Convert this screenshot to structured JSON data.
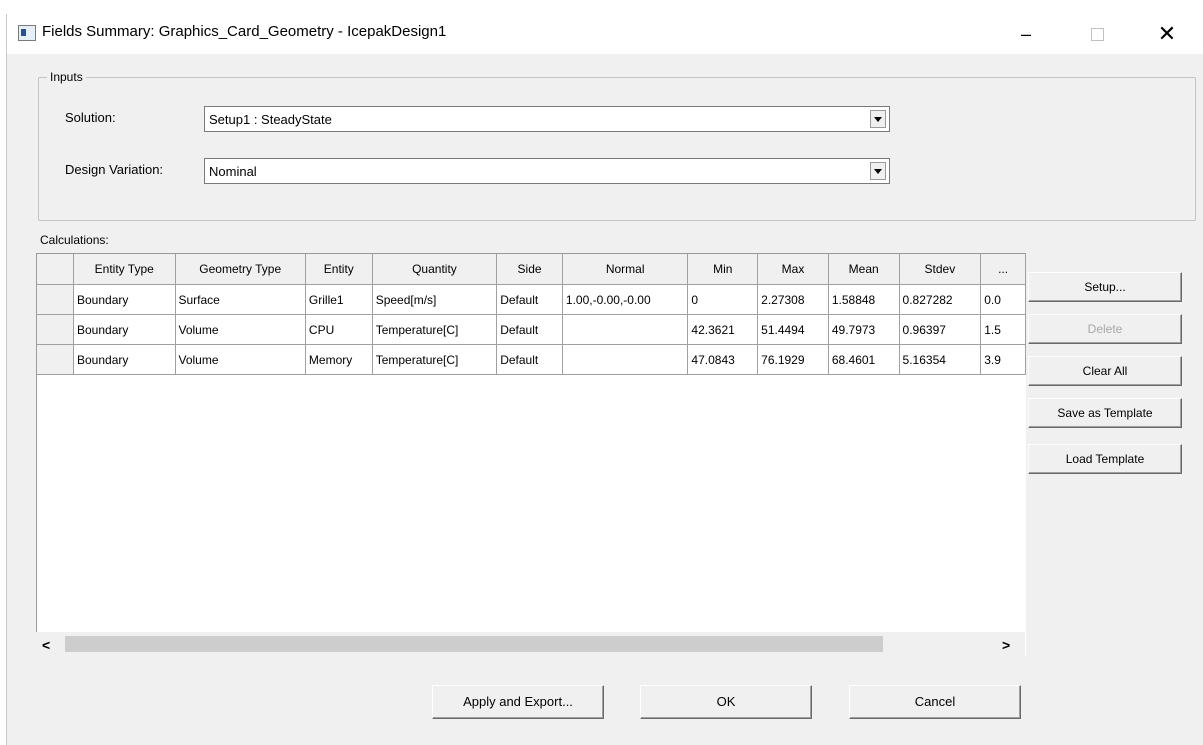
{
  "window": {
    "title": "Fields Summary: Graphics_Card_Geometry - IcepakDesign1",
    "minimize": "–",
    "close": "✕"
  },
  "inputs": {
    "legend": "Inputs",
    "solution_label": "Solution:",
    "solution_value": "Setup1 : SteadyState",
    "variation_label": "Design Variation:",
    "variation_value": "Nominal"
  },
  "calculations": {
    "label": "Calculations:",
    "columns": [
      "Entity Type",
      "Geometry Type",
      "Entity",
      "Quantity",
      "Side",
      "Normal",
      "Min",
      "Max",
      "Mean",
      "Stdev",
      "..."
    ],
    "rows": [
      [
        "Boundary",
        "Surface",
        "Grille1",
        "Speed[m/s]",
        "Default",
        "1.00,-0.00,-0.00",
        "0",
        "2.27308",
        "1.58848",
        "0.827282",
        "0.0"
      ],
      [
        "Boundary",
        "Volume",
        "CPU",
        "Temperature[C]",
        "Default",
        "",
        "42.3621",
        "51.4494",
        "49.7973",
        "0.96397",
        "1.5"
      ],
      [
        "Boundary",
        "Volume",
        "Memory",
        "Temperature[C]",
        "Default",
        "",
        "47.0843",
        "76.1929",
        "68.4601",
        "5.16354",
        "3.9"
      ]
    ]
  },
  "scroll": {
    "left": "<",
    "right": ">"
  },
  "side_buttons": {
    "setup": "Setup...",
    "delete": "Delete",
    "clear_all": "Clear All",
    "save_template": "Save as Template",
    "load_template": "Load Template"
  },
  "bottom_buttons": {
    "apply_export": "Apply and Export...",
    "ok": "OK",
    "cancel": "Cancel"
  }
}
